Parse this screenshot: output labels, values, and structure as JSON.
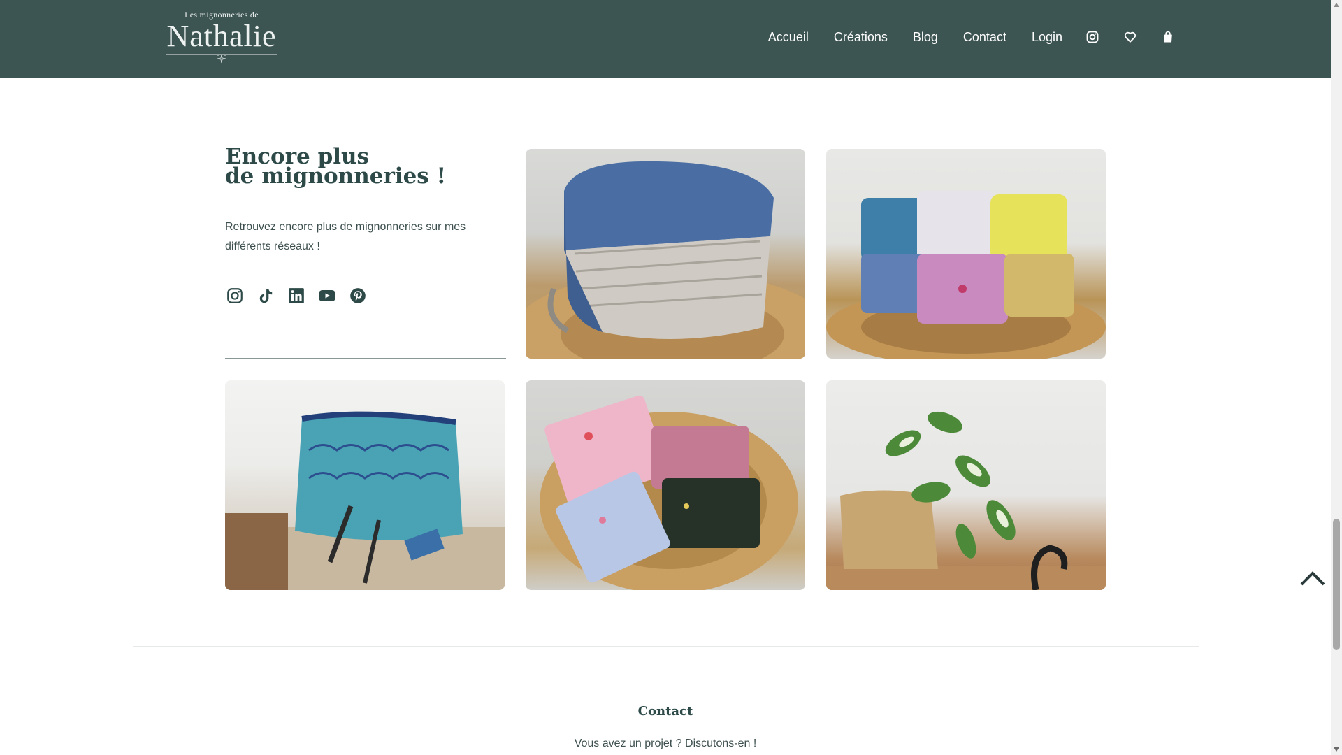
{
  "header": {
    "logo_small": "Les mignonneries de",
    "logo_big": "Nathalie",
    "nav": [
      {
        "label": "Accueil"
      },
      {
        "label": "Créations"
      },
      {
        "label": "Blog"
      },
      {
        "label": "Contact"
      },
      {
        "label": "Login"
      }
    ],
    "icons": [
      "instagram-icon",
      "heart-icon",
      "shopping-bag-icon"
    ],
    "background": "#3c5452"
  },
  "intro": {
    "title_line1": "Encore plus",
    "title_line2": "de mignonneries !",
    "text": "Retrouvez encore plus de mignonneries sur mes différents réseaux !",
    "socials": [
      "instagram-icon",
      "tiktok-icon",
      "linkedin-icon",
      "youtube-icon",
      "pinterest-icon"
    ]
  },
  "gallery": [
    {
      "subject": "blue-leather-toiletry-bag"
    },
    {
      "subject": "fabric-baskets"
    },
    {
      "subject": "patterned-pencil-pouch"
    },
    {
      "subject": "floral-fabric-pouches"
    },
    {
      "subject": "jute-plant-pot-cover"
    }
  ],
  "contact": {
    "title": "Contact",
    "text": "Vous avez un projet ? Discutons-en !"
  },
  "colors": {
    "brand_dark": "#3c5452",
    "heading": "#2d4a48",
    "text": "#3d4f4e"
  }
}
